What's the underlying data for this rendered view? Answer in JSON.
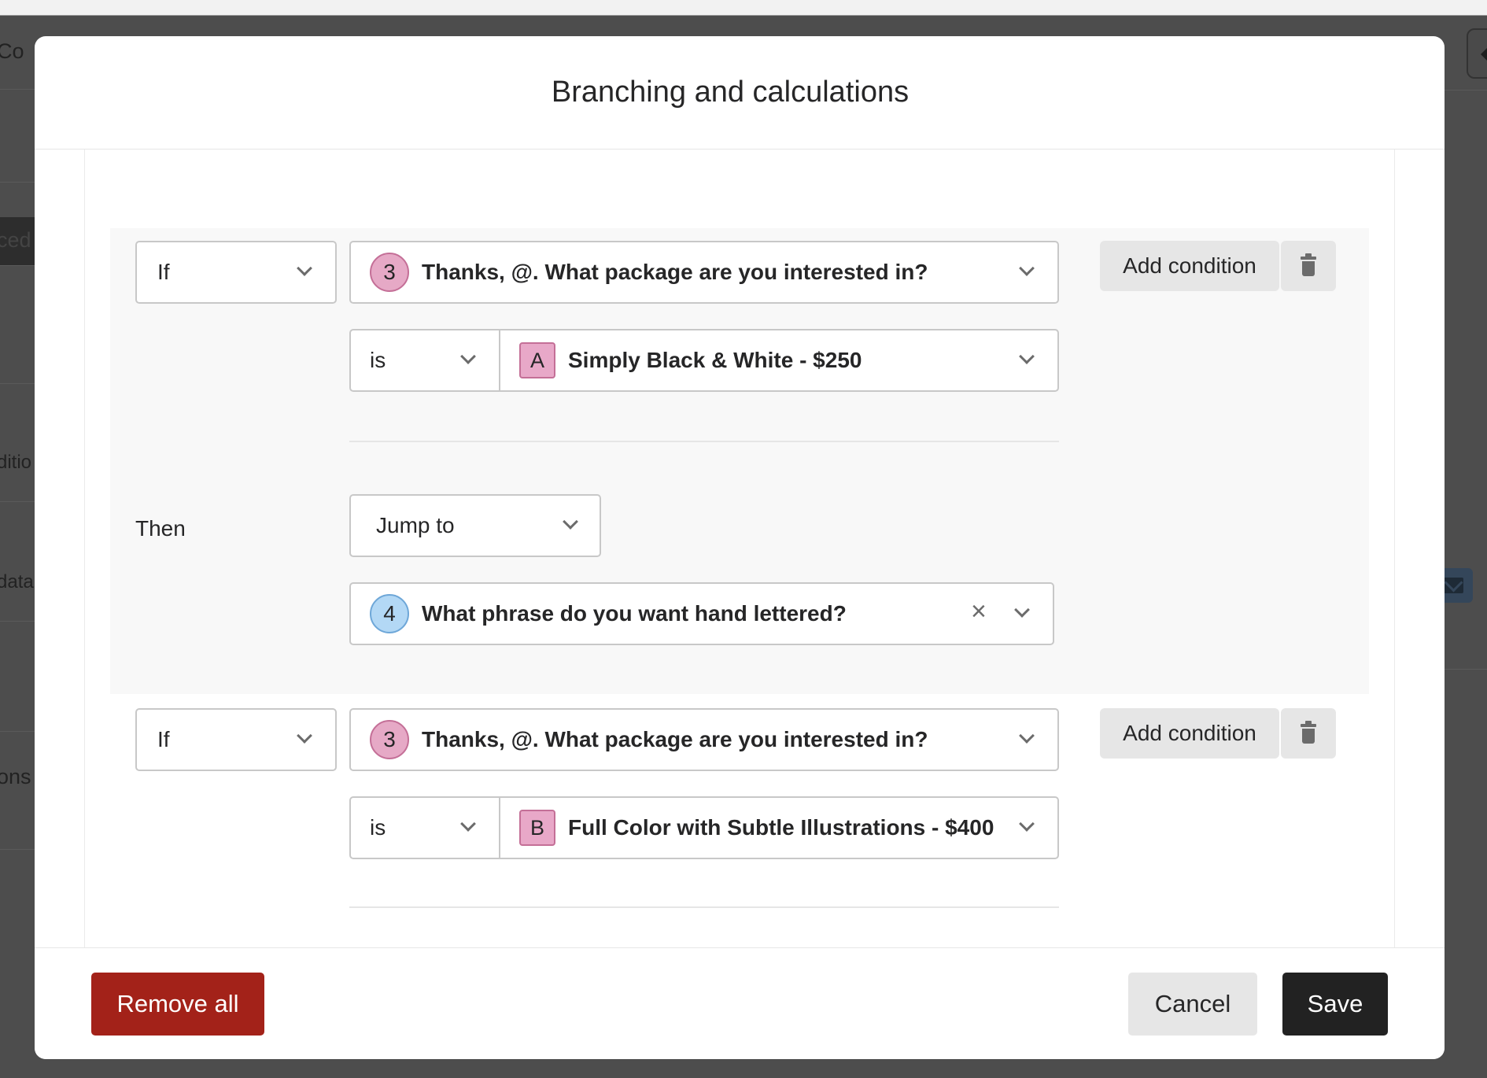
{
  "modal": {
    "title": "Branching and calculations"
  },
  "background": {
    "left_fragments": [
      "Co",
      "ced",
      "ditio",
      "data",
      "ons"
    ]
  },
  "rules": [
    {
      "if_label": "If",
      "question_number": "3",
      "question": "Thanks, @. What package are you interested in?",
      "operator": "is",
      "answer_letter": "A",
      "answer": "Simply Black & White - $250",
      "add_condition_label": "Add condition",
      "then_label": "Then",
      "action": "Jump to",
      "target_number": "4",
      "target": "What phrase do you want hand lettered?"
    },
    {
      "if_label": "If",
      "question_number": "3",
      "question": "Thanks, @. What package are you interested in?",
      "operator": "is",
      "answer_letter": "B",
      "answer": "Full Color with Subtle Illustrations - $400",
      "add_condition_label": "Add condition"
    }
  ],
  "footer": {
    "remove_all_label": "Remove all",
    "cancel_label": "Cancel",
    "save_label": "Save"
  },
  "colors": {
    "remove_button": "#a32219",
    "save_button": "#222222",
    "question_badge_pink": "#e6a9c6",
    "question_badge_blue": "#b3d8f5",
    "overlay": "#4d4d4d"
  }
}
